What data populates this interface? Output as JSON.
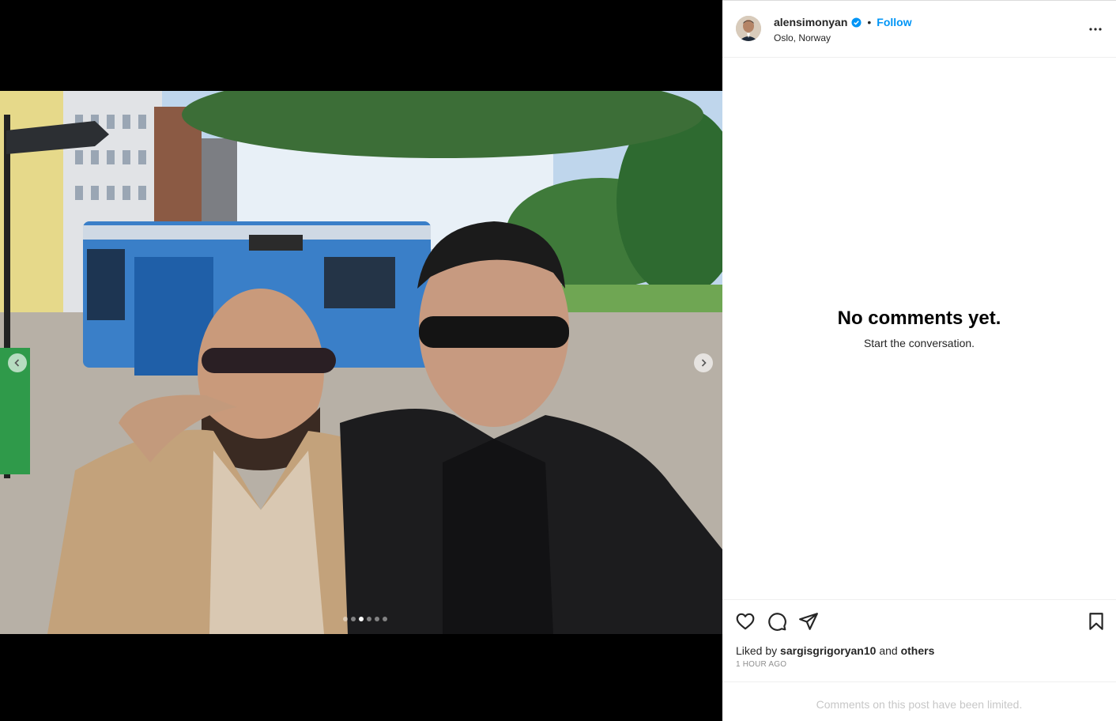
{
  "post": {
    "username": "alensimonyan",
    "separator": "•",
    "follow_label": "Follow",
    "location": "Oslo, Norway",
    "more_icon": "more-horizontal-icon"
  },
  "comments": {
    "empty_title": "No comments yet.",
    "empty_subtitle": "Start the conversation."
  },
  "engagement": {
    "liked_prefix": "Liked by ",
    "liked_user": "sargisgrigoryan10",
    "liked_and": " and ",
    "liked_others": "others",
    "time_ago": "1 hour ago",
    "limited_notice": "Comments on this post have been limited."
  },
  "carousel": {
    "total": 6,
    "active_index": 2
  },
  "colors": {
    "accent": "#0095f6",
    "verified": "#0095f6"
  }
}
